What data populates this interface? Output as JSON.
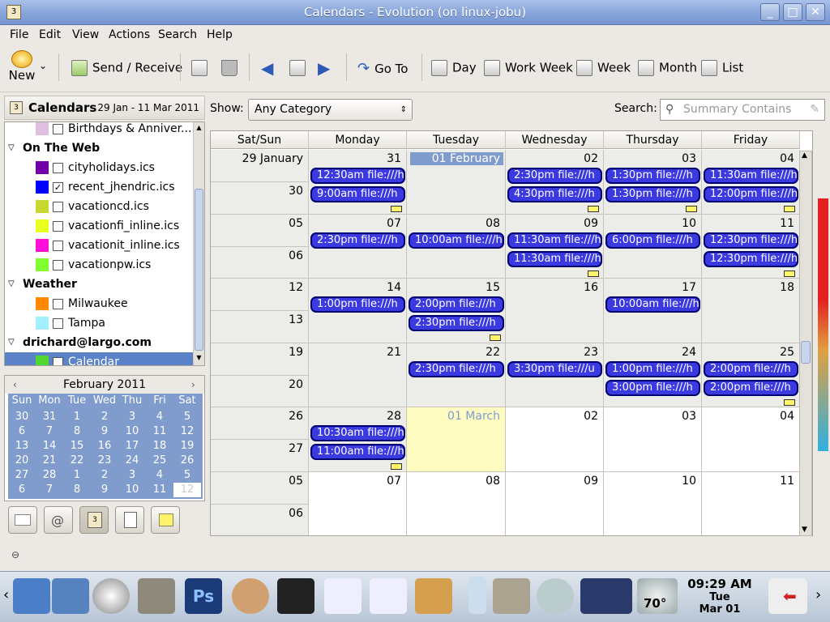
{
  "window": {
    "title": "Calendars - Evolution (on linux-jobu)"
  },
  "menu": [
    "File",
    "Edit",
    "View",
    "Actions",
    "Search",
    "Help"
  ],
  "toolbar": {
    "new": "New",
    "send_receive": "Send / Receive",
    "goto": "Go To",
    "day": "Day",
    "workweek": "Work Week",
    "week": "Week",
    "month": "Month",
    "list": "List"
  },
  "sidebar": {
    "title": "Calendars",
    "range": "29 Jan - 11 Mar 2011",
    "items": [
      {
        "type": "cal",
        "label": "Birthdays & Anniver...",
        "color": "#e0c0e0",
        "checked": false
      },
      {
        "type": "group",
        "label": "On The Web"
      },
      {
        "type": "cal",
        "label": "cityholidays.ics",
        "color": "#7000a8",
        "checked": false
      },
      {
        "type": "cal",
        "label": "recent_jhendric.ics",
        "color": "#0000ff",
        "checked": true
      },
      {
        "type": "cal",
        "label": "vacationcd.ics",
        "color": "#c8d830",
        "checked": false
      },
      {
        "type": "cal",
        "label": "vacationfi_inline.ics",
        "color": "#e8ff20",
        "checked": false
      },
      {
        "type": "cal",
        "label": "vacationit_inline.ics",
        "color": "#ff10d8",
        "checked": false
      },
      {
        "type": "cal",
        "label": "vacationpw.ics",
        "color": "#80ff30",
        "checked": false
      },
      {
        "type": "group",
        "label": "Weather"
      },
      {
        "type": "cal",
        "label": "Milwaukee",
        "color": "#ff8800",
        "checked": false
      },
      {
        "type": "cal",
        "label": "Tampa",
        "color": "#a0f0ff",
        "checked": false
      },
      {
        "type": "group",
        "label": "drichard@largo.com"
      },
      {
        "type": "cal",
        "label": "Calendar",
        "color": "#50d830",
        "checked": false,
        "selected": true
      }
    ]
  },
  "minical": {
    "title": "February 2011",
    "prev": "‹",
    "next": "›",
    "dow": [
      "Sun",
      "Mon",
      "Tue",
      "Wed",
      "Thu",
      "Fri",
      "Sat"
    ],
    "weeks": [
      [
        "30",
        "31",
        "1",
        "2",
        "3",
        "4",
        "5"
      ],
      [
        "6",
        "7",
        "8",
        "9",
        "10",
        "11",
        "12"
      ],
      [
        "13",
        "14",
        "15",
        "16",
        "17",
        "18",
        "19"
      ],
      [
        "20",
        "21",
        "22",
        "23",
        "24",
        "25",
        "26"
      ],
      [
        "27",
        "28",
        "1",
        "2",
        "3",
        "4",
        "5"
      ],
      [
        "6",
        "7",
        "8",
        "9",
        "10",
        "11",
        "12"
      ]
    ]
  },
  "filter": {
    "show_label": "Show:",
    "category": "Any Category",
    "search_label": "Search:",
    "search_placeholder": "Summary Contains"
  },
  "cal": {
    "headers": [
      "Sat/Sun",
      "Monday",
      "Tuesday",
      "Wednesday",
      "Thursday",
      "Friday"
    ],
    "weeks": [
      {
        "sat": "29 January",
        "sun": "30",
        "days": [
          "31",
          "01 February",
          "02",
          "03",
          "04"
        ]
      },
      {
        "sat": "05",
        "sun": "06",
        "days": [
          "07",
          "08",
          "09",
          "10",
          "11"
        ]
      },
      {
        "sat": "12",
        "sun": "13",
        "days": [
          "14",
          "15",
          "16",
          "17",
          "18"
        ]
      },
      {
        "sat": "19",
        "sun": "20",
        "days": [
          "21",
          "22",
          "23",
          "24",
          "25"
        ]
      },
      {
        "sat": "26",
        "sun": "27",
        "days": [
          "28",
          "01 March",
          "02",
          "03",
          "04"
        ]
      },
      {
        "sat": "05",
        "sun": "06",
        "days": [
          "07",
          "08",
          "09",
          "10",
          "11"
        ]
      }
    ],
    "events": [
      {
        "w": 0,
        "d": 0,
        "slot": 0,
        "text": "12:30am   file:///h"
      },
      {
        "w": 0,
        "d": 0,
        "slot": 1,
        "text": "9:00am    file:///h"
      },
      {
        "w": 0,
        "d": 2,
        "slot": 0,
        "text": "2:30pm    file:///h"
      },
      {
        "w": 0,
        "d": 2,
        "slot": 1,
        "text": "4:30pm    file:///h"
      },
      {
        "w": 0,
        "d": 3,
        "slot": 0,
        "text": "1:30pm    file:///h"
      },
      {
        "w": 0,
        "d": 3,
        "slot": 1,
        "text": "1:30pm    file:///h"
      },
      {
        "w": 0,
        "d": 4,
        "slot": 0,
        "text": "11:30am   file:///h"
      },
      {
        "w": 0,
        "d": 4,
        "slot": 1,
        "text": "12:00pm   file:///h"
      },
      {
        "w": 1,
        "d": 0,
        "slot": 0,
        "text": "2:30pm    file:///h"
      },
      {
        "w": 1,
        "d": 1,
        "slot": 0,
        "text": "10:00am   file:///h"
      },
      {
        "w": 1,
        "d": 2,
        "slot": 0,
        "text": "11:30am   file:///h"
      },
      {
        "w": 1,
        "d": 2,
        "slot": 1,
        "text": "11:30am   file:///h"
      },
      {
        "w": 1,
        "d": 3,
        "slot": 0,
        "text": "6:00pm    file:///h"
      },
      {
        "w": 1,
        "d": 4,
        "slot": 0,
        "text": "12:30pm   file:///h"
      },
      {
        "w": 1,
        "d": 4,
        "slot": 1,
        "text": "12:30pm   file:///h"
      },
      {
        "w": 2,
        "d": 0,
        "slot": 0,
        "text": "1:00pm    file:///h"
      },
      {
        "w": 2,
        "d": 1,
        "slot": 0,
        "text": "2:00pm    file:///h"
      },
      {
        "w": 2,
        "d": 1,
        "slot": 1,
        "text": "2:30pm    file:///h"
      },
      {
        "w": 2,
        "d": 3,
        "slot": 0,
        "text": "10:00am   file:///h"
      },
      {
        "w": 3,
        "d": 1,
        "slot": 0,
        "text": "2:30pm    file:///h"
      },
      {
        "w": 3,
        "d": 2,
        "slot": 0,
        "text": "3:30pm    file:///u"
      },
      {
        "w": 3,
        "d": 3,
        "slot": 0,
        "text": "1:00pm    file:///h"
      },
      {
        "w": 3,
        "d": 3,
        "slot": 1,
        "text": "3:00pm    file:///h"
      },
      {
        "w": 3,
        "d": 4,
        "slot": 0,
        "text": "2:00pm    file:///h"
      },
      {
        "w": 3,
        "d": 4,
        "slot": 1,
        "text": "2:00pm    file:///h"
      },
      {
        "w": 4,
        "d": 0,
        "slot": 0,
        "text": "10:30am   file:///h"
      },
      {
        "w": 4,
        "d": 0,
        "slot": 1,
        "text": "11:00am   file:///h"
      }
    ],
    "more": [
      {
        "w": 0,
        "d": 0
      },
      {
        "w": 0,
        "d": 2
      },
      {
        "w": 0,
        "d": 3
      },
      {
        "w": 0,
        "d": 4
      },
      {
        "w": 1,
        "d": 2
      },
      {
        "w": 1,
        "d": 4
      },
      {
        "w": 2,
        "d": 1
      },
      {
        "w": 3,
        "d": 4
      },
      {
        "w": 4,
        "d": 0
      }
    ]
  },
  "taskbar": {
    "time": "09:29 AM",
    "day": "Tue",
    "date": "Mar 01",
    "temp": "70°"
  }
}
